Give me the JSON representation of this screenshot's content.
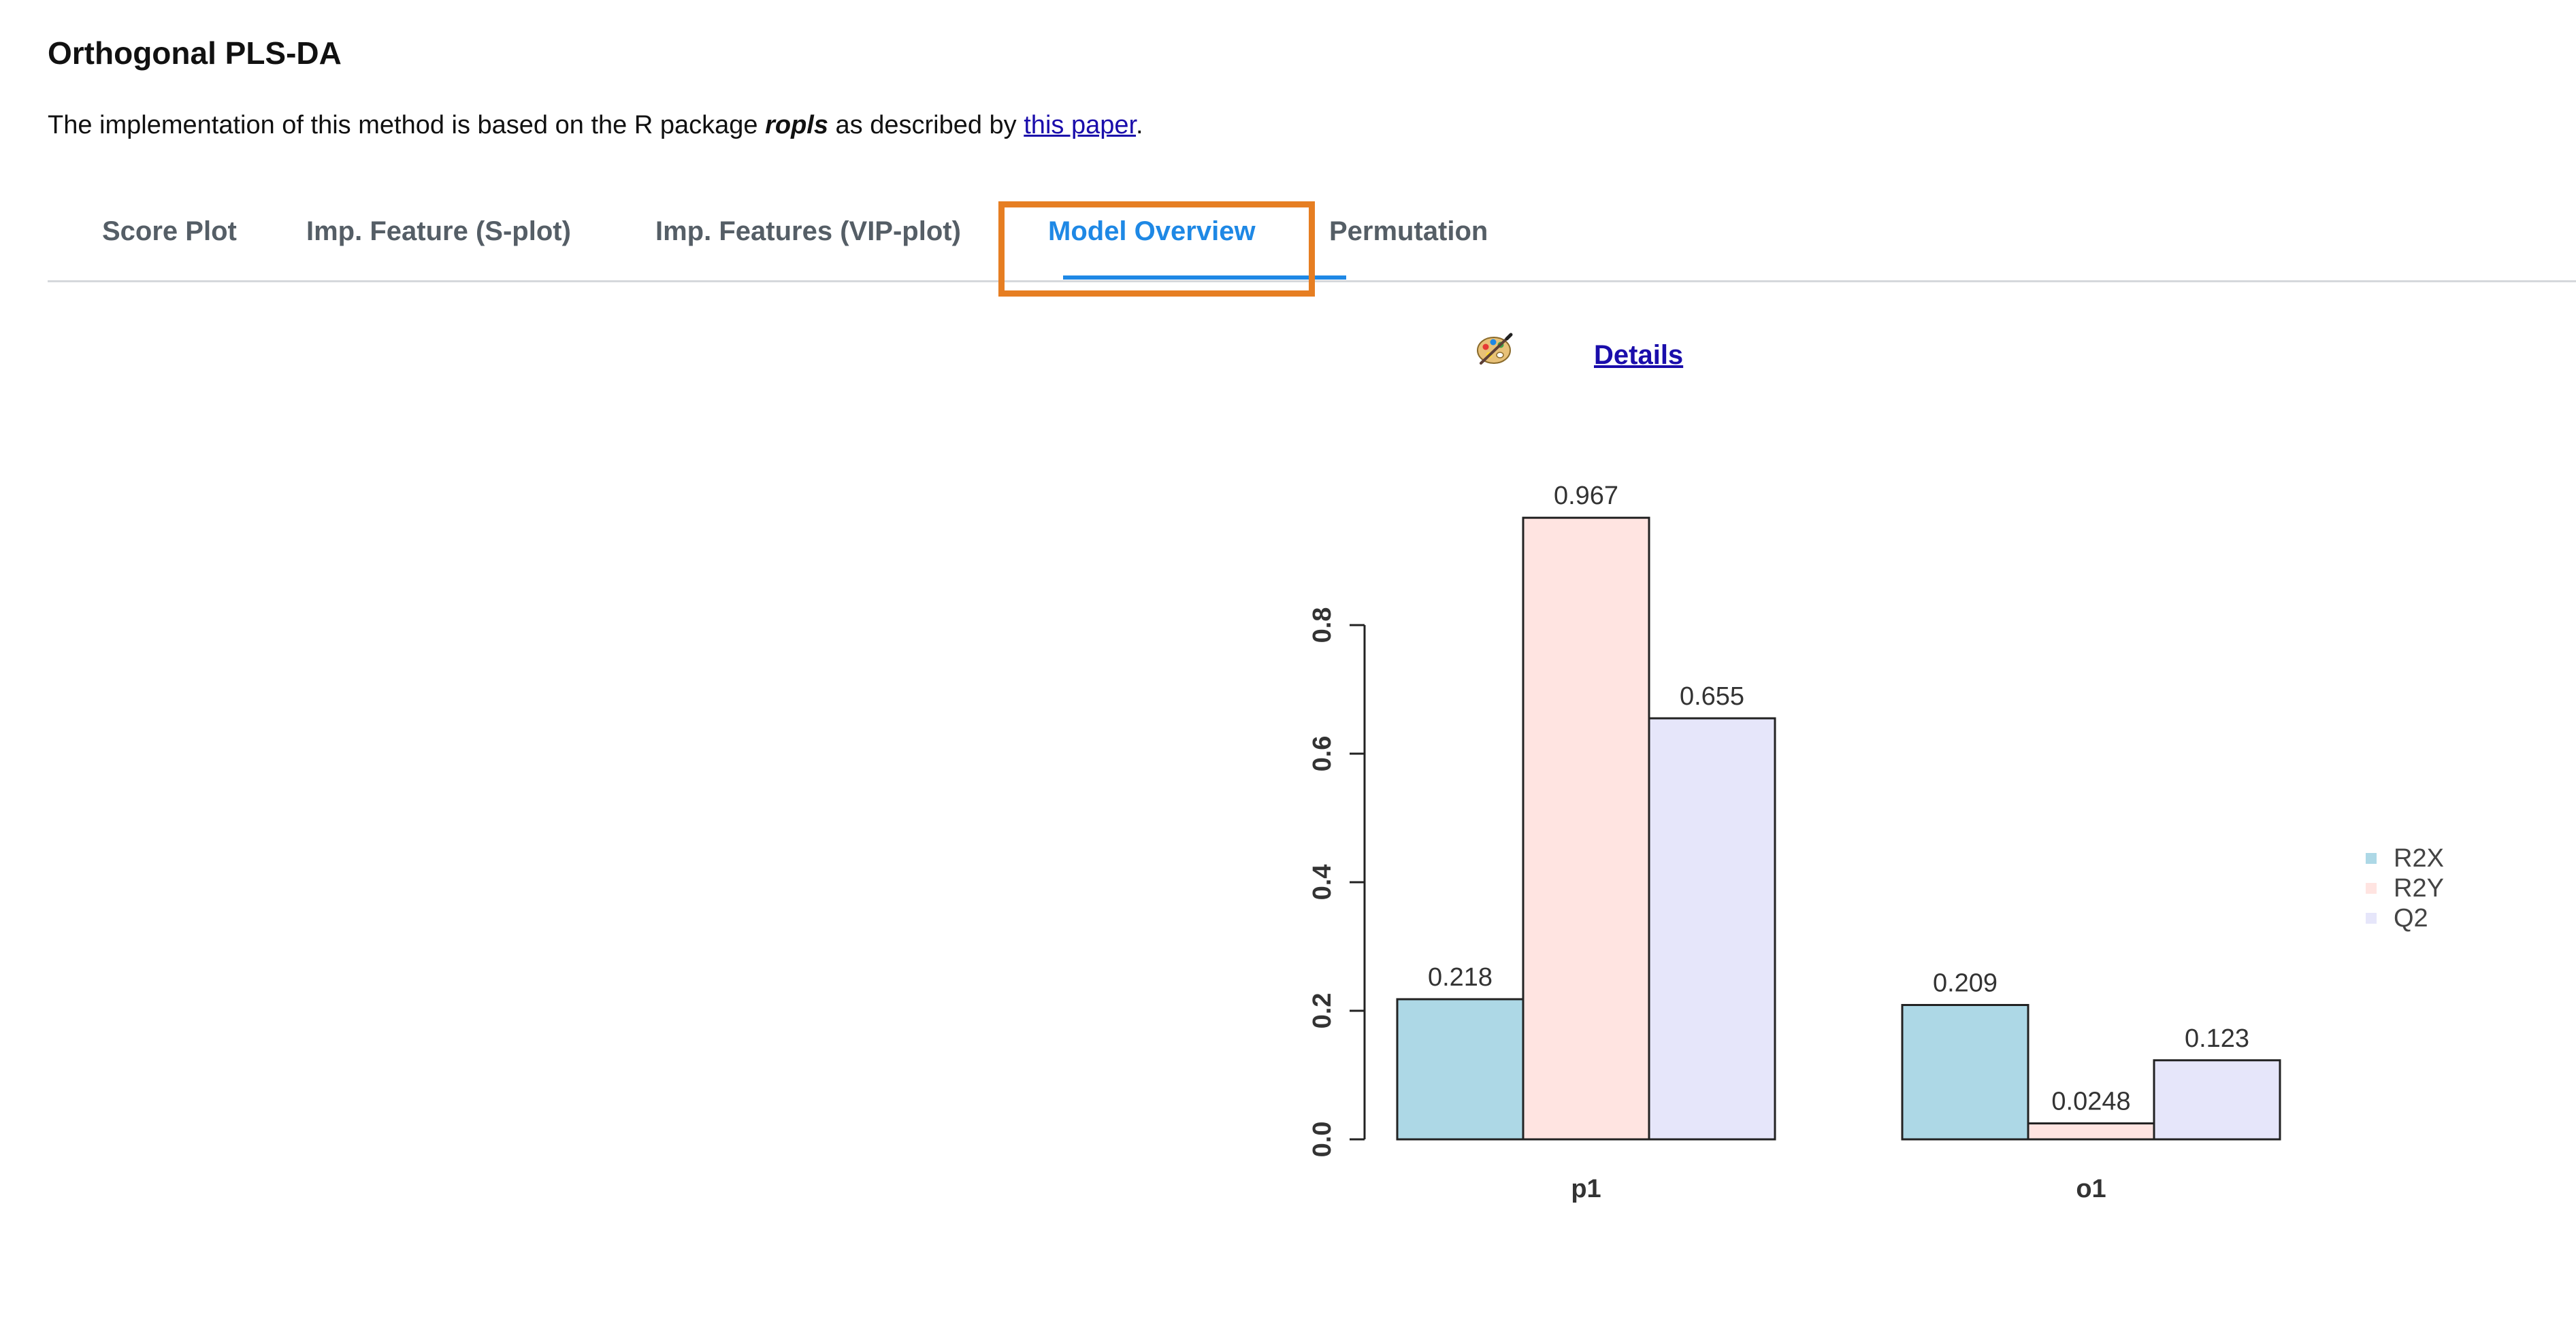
{
  "page": {
    "title": "Orthogonal PLS-DA",
    "intro_prefix": "The implementation of this method is based on the R package",
    "intro_package": "ropls",
    "intro_middle": "as described by",
    "intro_link": "this paper",
    "intro_suffix": "."
  },
  "tabs": [
    {
      "label": "Score Plot",
      "active": false
    },
    {
      "label": "Imp. Feature (S-plot)",
      "active": false
    },
    {
      "label": "Imp. Features (VIP-plot)",
      "active": false
    },
    {
      "label": "Model Overview",
      "active": true
    },
    {
      "label": "Permutation",
      "active": false
    }
  ],
  "toolbar": {
    "palette_icon": "palette-icon",
    "details_label": "Details"
  },
  "colors": {
    "accent": "#1e88e5",
    "highlight": "#e67e22",
    "link": "#1a0dab",
    "R2X": "#add8e6",
    "R2Y": "#ffe4e1",
    "Q2": "#e6e6fa"
  },
  "chart_data": {
    "type": "bar",
    "categories": [
      "p1",
      "o1"
    ],
    "series": [
      {
        "name": "R2X",
        "values": [
          0.218,
          0.209
        ],
        "labels": [
          "0.218",
          "0.209"
        ]
      },
      {
        "name": "R2Y",
        "values": [
          0.967,
          0.0248
        ],
        "labels": [
          "0.967",
          "0.0248"
        ]
      },
      {
        "name": "Q2",
        "values": [
          0.655,
          0.123
        ],
        "labels": [
          "0.655",
          "0.123"
        ]
      }
    ],
    "y_ticks": [
      "0.0",
      "0.2",
      "0.4",
      "0.6",
      "0.8"
    ],
    "ylim": [
      0,
      0.8
    ],
    "legend_position": "right",
    "grid": false
  }
}
